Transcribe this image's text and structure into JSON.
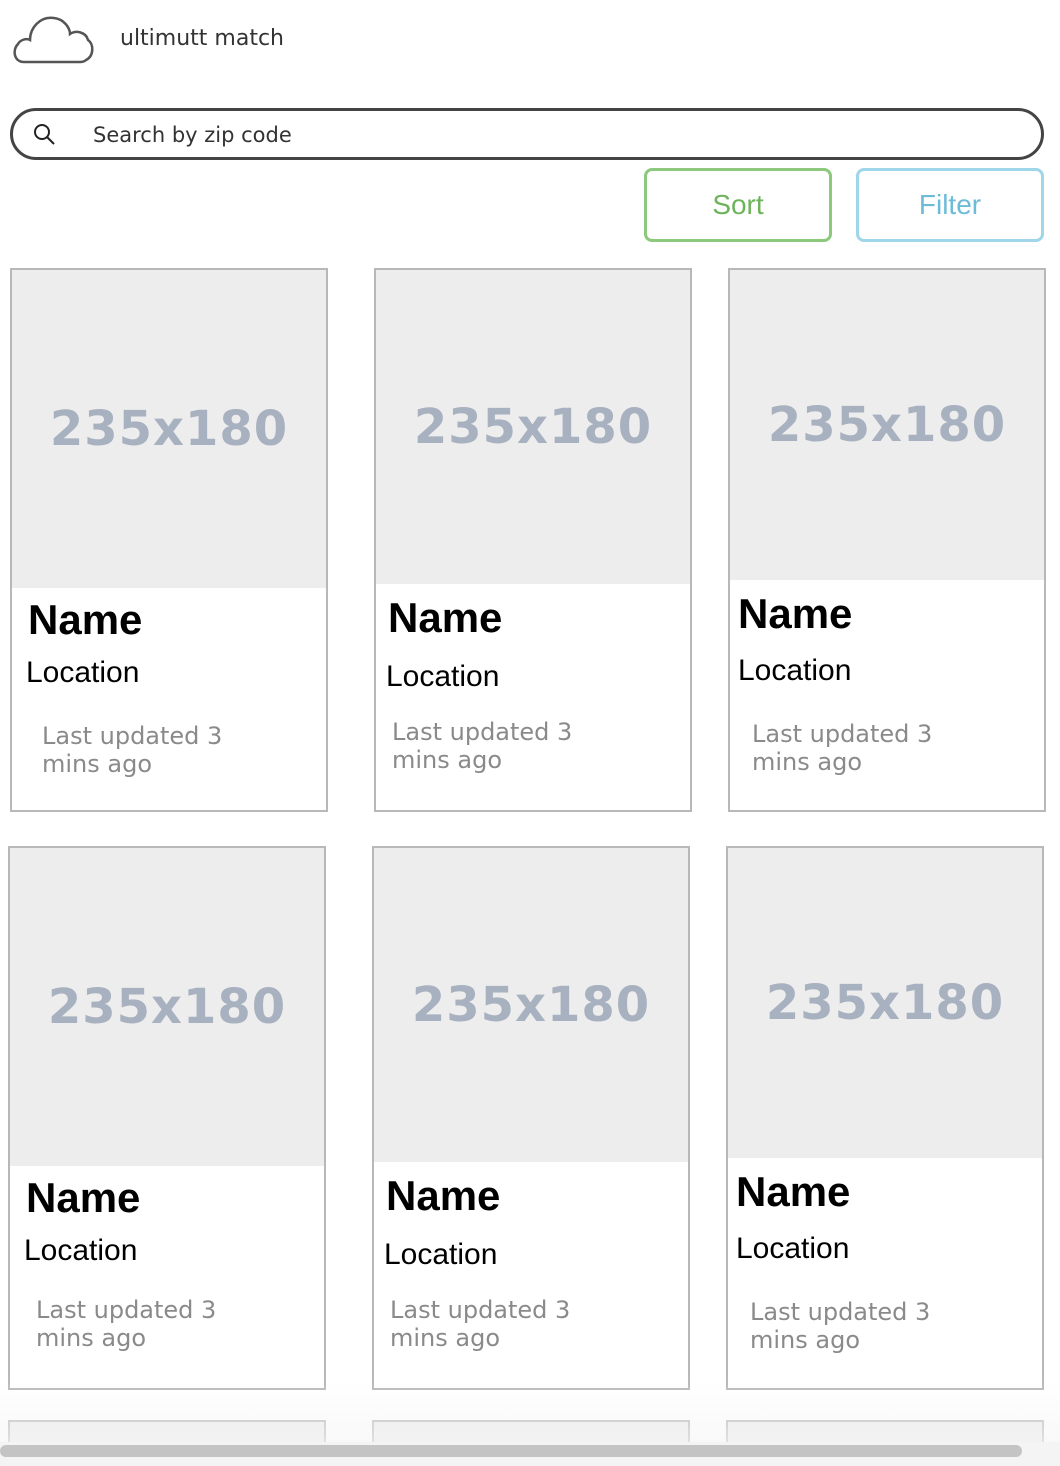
{
  "header": {
    "logo_icon": "cloud-icon",
    "app_title": "ultimutt match"
  },
  "search": {
    "icon": "search-icon",
    "placeholder": "Search by zip code"
  },
  "actions": {
    "sort_label": "Sort",
    "filter_label": "Filter",
    "sort_color": "#6cb35a",
    "filter_color": "#6cbcd8"
  },
  "cards": [
    {
      "image_placeholder": "235x180",
      "name": "Name",
      "location": "Location",
      "updated_line1": "Last updated 3",
      "updated_line2": "mins ago"
    },
    {
      "image_placeholder": "235x180",
      "name": "Name",
      "location": "Location",
      "updated_line1": "Last updated 3",
      "updated_line2": "mins ago"
    },
    {
      "image_placeholder": "235x180",
      "name": "Name",
      "location": "Location",
      "updated_line1": "Last updated 3",
      "updated_line2": "mins ago"
    },
    {
      "image_placeholder": "235x180",
      "name": "Name",
      "location": "Location",
      "updated_line1": "Last updated 3",
      "updated_line2": "mins ago"
    },
    {
      "image_placeholder": "235x180",
      "name": "Name",
      "location": "Location",
      "updated_line1": "Last updated 3",
      "updated_line2": "mins ago"
    },
    {
      "image_placeholder": "235x180",
      "name": "Name",
      "location": "Location",
      "updated_line1": "Last updated 3",
      "updated_line2": "mins ago"
    }
  ]
}
